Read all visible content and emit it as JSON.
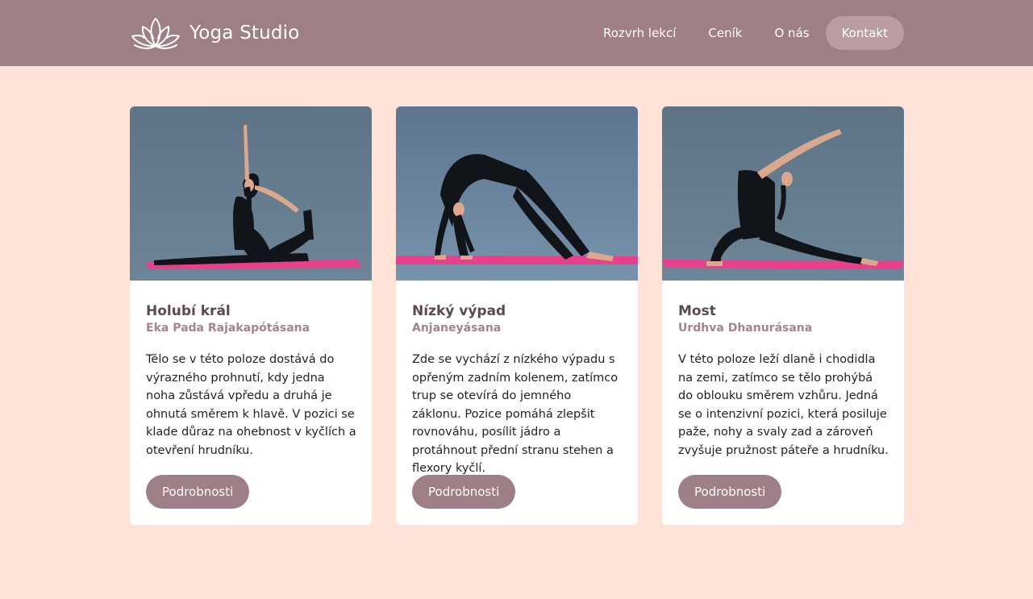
{
  "header": {
    "logo_icon": "lotus-icon",
    "brand": "Yoga Studio",
    "nav": [
      {
        "label": "Rozvrh lekcí"
      },
      {
        "label": "Ceník"
      },
      {
        "label": "O nás"
      }
    ],
    "contact_label": "Kontakt"
  },
  "colors": {
    "header_bg": "#9e7f86",
    "page_bg": "#ffe3d8",
    "button_bg": "#9e7f86",
    "contact_bg": "#b99da3",
    "subtitle": "#a4848c",
    "title": "#5b4a4e",
    "mat": "#e8408a",
    "photo_bg": "#5d7588"
  },
  "cards": [
    {
      "image": "yoga-pose-pigeon-photo",
      "title": "Holubí král",
      "subtitle": "Eka Pada Rajakapótásana",
      "description": "Tělo se v této poloze dostává do výrazného prohnutí, kdy jedna noha zůstává vpředu a druhá je ohnutá směrem k hlavě. V pozici se klade důraz na ohebnost v kyčlích a otevření hrudníku.",
      "button": "Podrobnosti"
    },
    {
      "image": "yoga-pose-low-lunge-photo",
      "title": "Nízký výpad",
      "subtitle": "Anjaneyásana",
      "description": "Zde se vychází z nízkého výpadu s opřeným zadním kolenem, zatímco trup se otevírá do jemného záklonu. Pozice pomáhá zlepšit rovnováhu, posílit jádro a protáhnout přední stranu stehen a flexory kyčlí.",
      "button": "Podrobnosti"
    },
    {
      "image": "yoga-pose-bridge-photo",
      "title": "Most",
      "subtitle": "Urdhva Dhanurásana",
      "description": "V této poloze leží dlaně i chodidla na zemi, zatímco se tělo prohýbá do oblouku směrem vzhůru. Jedná se o intenzivní pozici, která posiluje paže, nohy a svaly zad a zároveň zvyšuje pružnost páteře a hrudníku.",
      "button": "Podrobnosti"
    }
  ]
}
